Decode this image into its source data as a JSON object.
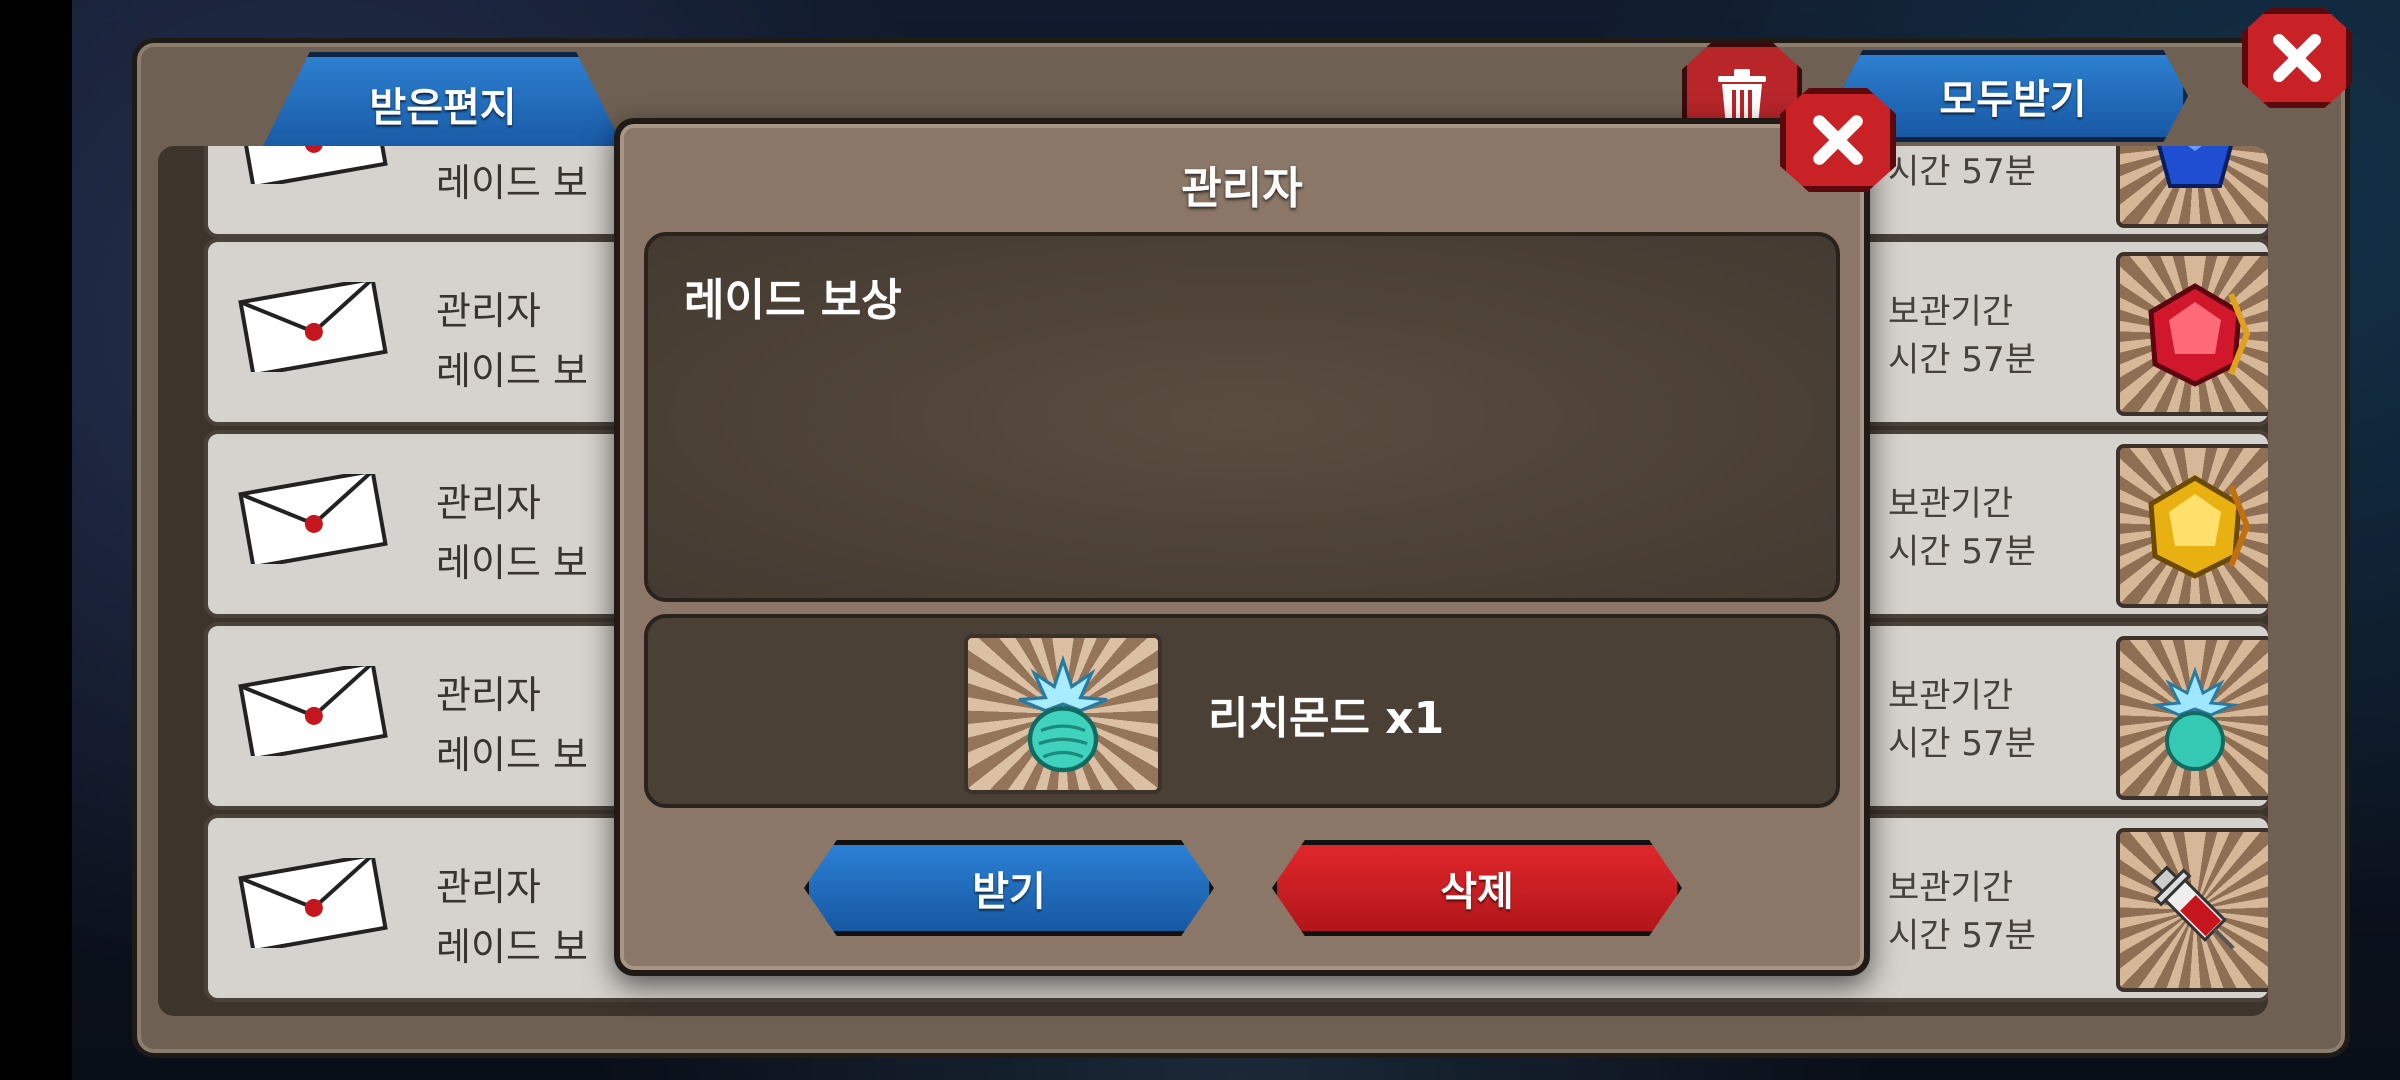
{
  "mailbox": {
    "tab_label": "받은편지",
    "claim_all_label": "모두받기",
    "rows": [
      {
        "sender": "",
        "title": "레이드 보",
        "period": "",
        "remaining": "시간 57분",
        "item": "blue-gem-icon"
      },
      {
        "sender": "관리자",
        "title": "레이드 보",
        "period": "보관기간",
        "remaining": "시간 57분",
        "item": "red-gem-icon"
      },
      {
        "sender": "관리자",
        "title": "레이드 보",
        "period": "보관기간",
        "remaining": "시간 57분",
        "item": "gold-gem-icon"
      },
      {
        "sender": "관리자",
        "title": "레이드 보",
        "period": "보관기간",
        "remaining": "시간 57분",
        "item": "richmond-icon"
      },
      {
        "sender": "관리자",
        "title": "레이드 보",
        "period": "보관기간",
        "remaining": "시간 57분",
        "item": "syringe-icon"
      }
    ]
  },
  "modal": {
    "title": "관리자",
    "message": "레이드 보상",
    "reward_label": "리치몬드 x1",
    "reward_icon": "richmond-icon",
    "receive_label": "받기",
    "delete_label": "삭제"
  },
  "colors": {
    "blue_button": "#1859a4",
    "red_button": "#c82227",
    "panel": "#8a7767"
  }
}
